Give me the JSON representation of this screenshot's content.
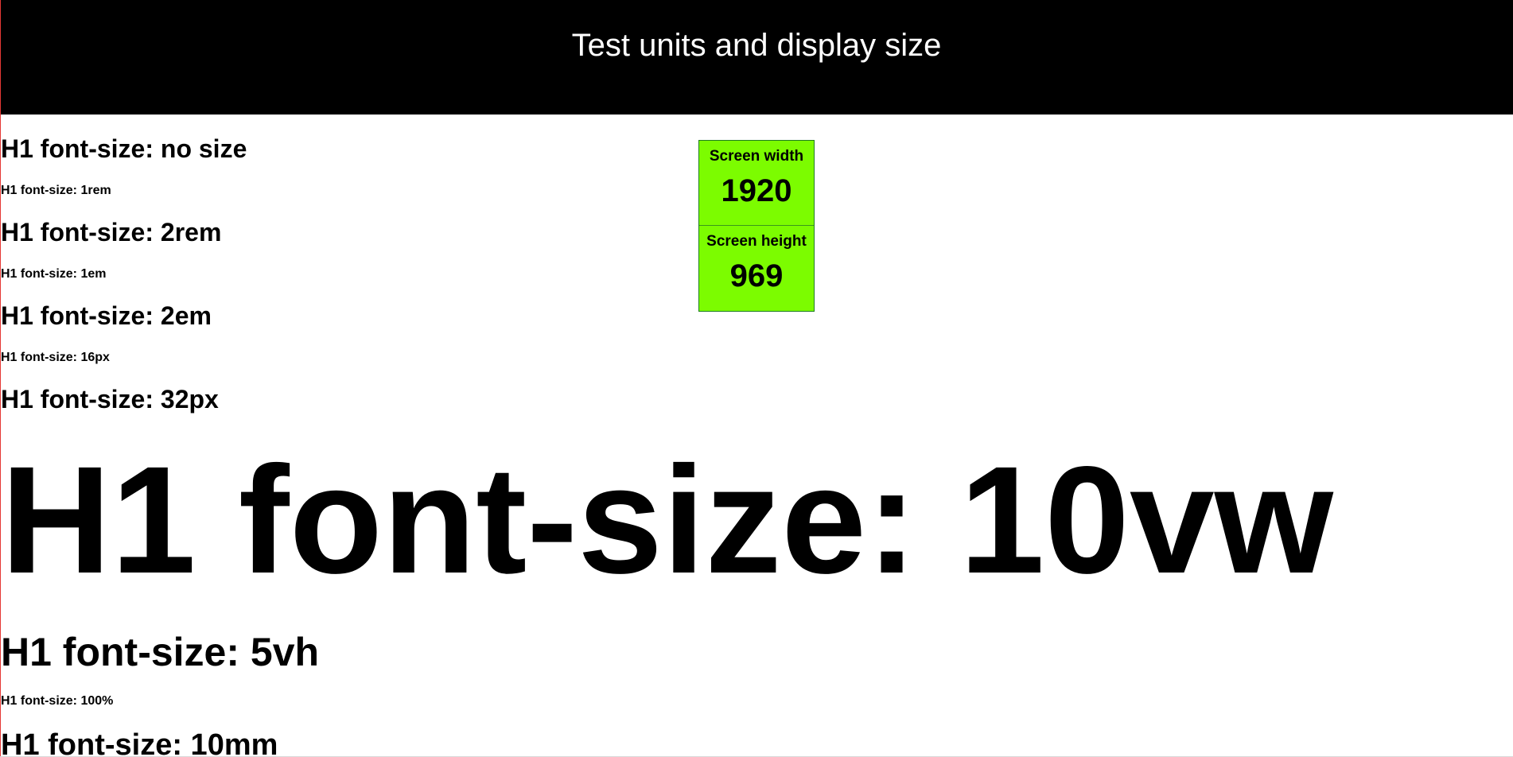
{
  "header": {
    "title": "Test units and display size"
  },
  "headings": {
    "no_size": "H1 font-size: no size",
    "rem1": "H1 font-size: 1rem",
    "rem2": "H1 font-size: 2rem",
    "em1": "H1 font-size: 1em",
    "em2": "H1 font-size: 2em",
    "px16": "H1 font-size: 16px",
    "px32": "H1 font-size: 32px",
    "vw10": "H1 font-size: 10vw",
    "vh5": "H1 font-size: 5vh",
    "pct100": "H1 font-size: 100%",
    "mm10": "H1 font-size: 10mm"
  },
  "screen_panel": {
    "width_label": "Screen width",
    "width_value": "1920",
    "height_label": "Screen height",
    "height_value": "969",
    "background_color": "#7cfc00"
  }
}
